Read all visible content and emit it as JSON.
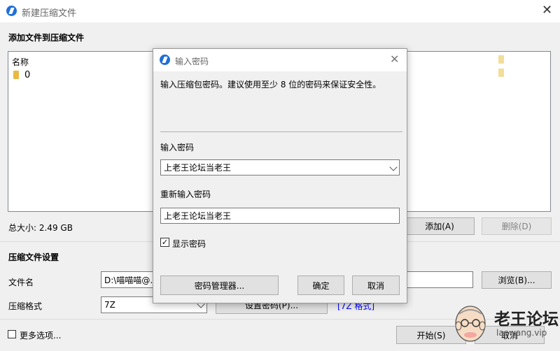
{
  "main_window": {
    "title": "新建压缩文件",
    "section_add": "添加文件到压缩文件",
    "list_header": "名称",
    "list_items": [
      {
        "name": "0"
      }
    ],
    "total_size": "总大小: 2.49 GB",
    "add_button": "添加(A)",
    "delete_button": "删除(D)",
    "settings_section": "压缩文件设置",
    "filename_label": "文件名",
    "filename_value": "D:\\喵喵喵@.",
    "browse_button": "浏览(B)...",
    "format_label": "压缩格式",
    "format_value": "7Z",
    "set_password_button": "设置密码(P)...",
    "format_link": "[7Z 格式]",
    "more_options": "更多选项...",
    "start_button": "开始(S)",
    "cancel_button": "取消"
  },
  "dialog": {
    "title": "输入密码",
    "description": "输入压缩包密码。建议使用至少 8 位的密码来保证安全性。",
    "password_label": "输入密码",
    "password_value": "上老王论坛当老王",
    "reenter_label": "重新输入密码",
    "reenter_value": "上老王论坛当老王",
    "show_password_label": "显示密码",
    "show_password_checked": true,
    "manager_button": "密码管理器...",
    "ok_button": "确定",
    "cancel_button": "取消"
  },
  "watermark": {
    "title": "老王论坛",
    "url": "laowang.vip"
  },
  "colors": {
    "accent": "#1e6fd9",
    "link": "#0000ff",
    "folder": "#e8b943"
  }
}
